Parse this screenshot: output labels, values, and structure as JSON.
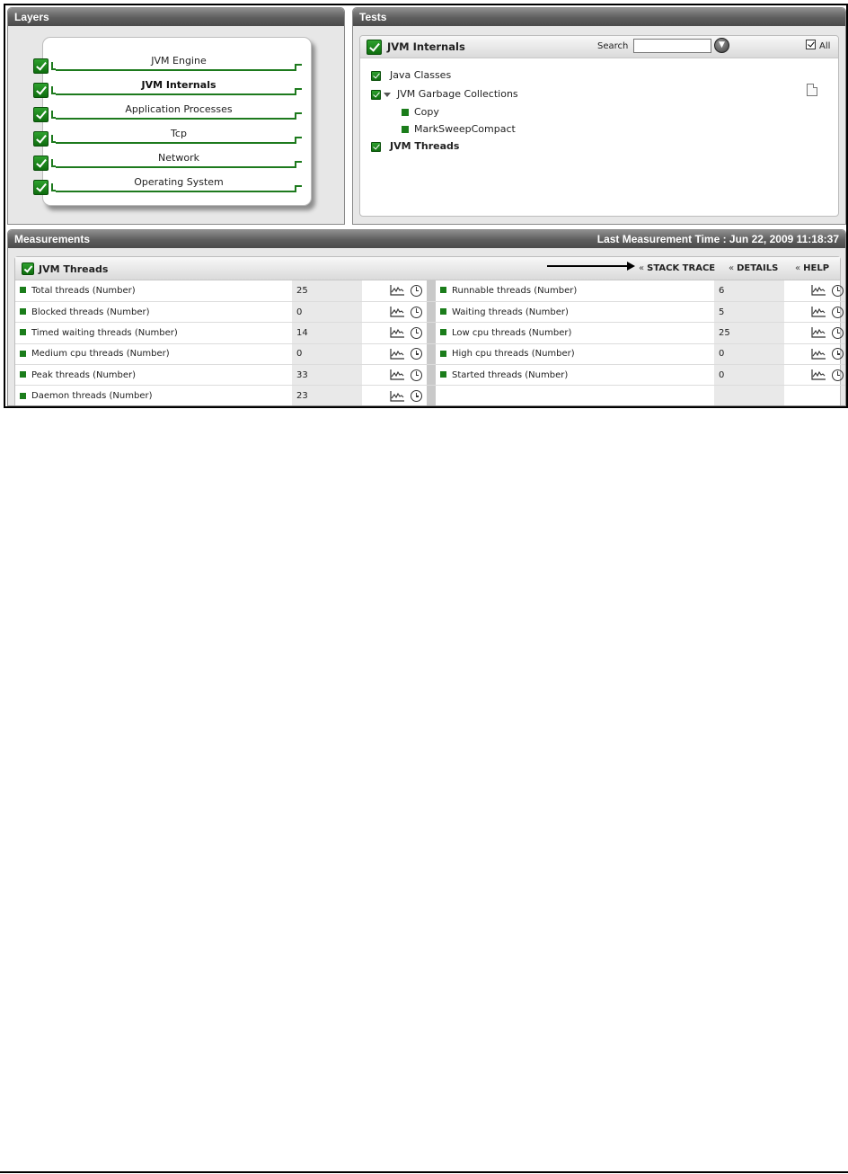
{
  "layers": {
    "title": "Layers",
    "items": [
      {
        "label": "JVM Engine",
        "active": false
      },
      {
        "label": "JVM Internals",
        "active": true
      },
      {
        "label": "Application Processes",
        "active": false
      },
      {
        "label": "Tcp",
        "active": false
      },
      {
        "label": "Network",
        "active": false
      },
      {
        "label": "Operating System",
        "active": false
      }
    ]
  },
  "tests": {
    "title": "Tests",
    "header_title": "JVM Internals",
    "search_label": "Search",
    "search_value": "",
    "all_label": "All",
    "items": [
      {
        "label": "Java Classes"
      },
      {
        "label": "JVM Garbage Collections"
      },
      {
        "label": "Copy"
      },
      {
        "label": "MarkSweepCompact"
      },
      {
        "label": "JVM Threads"
      }
    ]
  },
  "measurements": {
    "title": "Measurements",
    "last_time": "Last Measurement Time : Jun 22, 2009 11:18:37",
    "test_title": "JVM Threads",
    "links": {
      "stack_trace": "STACK TRACE",
      "details": "DETAILS",
      "help": "HELP"
    },
    "left": [
      {
        "name": "Total threads (Number)",
        "value": "25"
      },
      {
        "name": "Blocked threads (Number)",
        "value": "0"
      },
      {
        "name": "Timed waiting threads (Number)",
        "value": "14"
      },
      {
        "name": "Medium cpu threads (Number)",
        "value": "0"
      },
      {
        "name": "Peak threads (Number)",
        "value": "33"
      },
      {
        "name": "Daemon threads (Number)",
        "value": "23"
      }
    ],
    "right": [
      {
        "name": "Runnable threads (Number)",
        "value": "6"
      },
      {
        "name": "Waiting threads (Number)",
        "value": "5"
      },
      {
        "name": "Low cpu threads (Number)",
        "value": "25"
      },
      {
        "name": "High cpu threads (Number)",
        "value": "0"
      },
      {
        "name": "Started threads (Number)",
        "value": "0"
      }
    ]
  },
  "colors": {
    "accent_green": "#1b7d1b",
    "header_gray": "#5d5d5d"
  }
}
